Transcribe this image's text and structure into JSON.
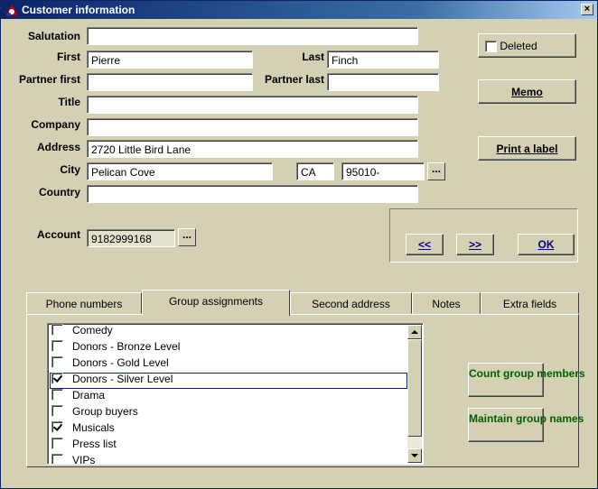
{
  "window": {
    "title": "Customer information",
    "close_label": "×"
  },
  "form": {
    "salutation": {
      "label": "Salutation",
      "value": ""
    },
    "first": {
      "label": "First",
      "value": "Pierre"
    },
    "last": {
      "label": "Last",
      "value": "Finch"
    },
    "partner_first": {
      "label": "Partner first",
      "value": ""
    },
    "partner_last": {
      "label": "Partner last",
      "value": ""
    },
    "title": {
      "label": "Title",
      "value": ""
    },
    "company": {
      "label": "Company",
      "value": ""
    },
    "address": {
      "label": "Address",
      "value": "2720 Little Bird Lane"
    },
    "city": {
      "label": "City",
      "value": "Pelican Cove"
    },
    "state": {
      "value": "CA"
    },
    "zip": {
      "value": "95010-"
    },
    "country": {
      "label": "Country",
      "value": ""
    },
    "account": {
      "label": "Account",
      "value": "9182999168"
    },
    "ellipsis": "..."
  },
  "side": {
    "deleted_label": "Deleted",
    "deleted_checked": false,
    "memo": "Memo",
    "print_label": "Print a label"
  },
  "nav": {
    "prev": "<<",
    "next": ">>",
    "ok": "OK"
  },
  "tabs": [
    {
      "label": "Phone numbers",
      "active": false
    },
    {
      "label": "Group assignments",
      "active": true
    },
    {
      "label": "Second address",
      "active": false
    },
    {
      "label": "Notes",
      "active": false
    },
    {
      "label": "Extra fields",
      "active": false
    }
  ],
  "groups": [
    {
      "label": "Comedy",
      "checked": false
    },
    {
      "label": "Donors - Bronze Level",
      "checked": false
    },
    {
      "label": "Donors - Gold Level",
      "checked": false
    },
    {
      "label": "Donors - Silver Level",
      "checked": true
    },
    {
      "label": "Drama",
      "checked": false
    },
    {
      "label": "Group buyers",
      "checked": false
    },
    {
      "label": "Musicals",
      "checked": true
    },
    {
      "label": "Press list",
      "checked": false
    },
    {
      "label": "VIPs",
      "checked": false
    }
  ],
  "group_buttons": {
    "count": "Count group members",
    "maintain": "Maintain group names"
  }
}
